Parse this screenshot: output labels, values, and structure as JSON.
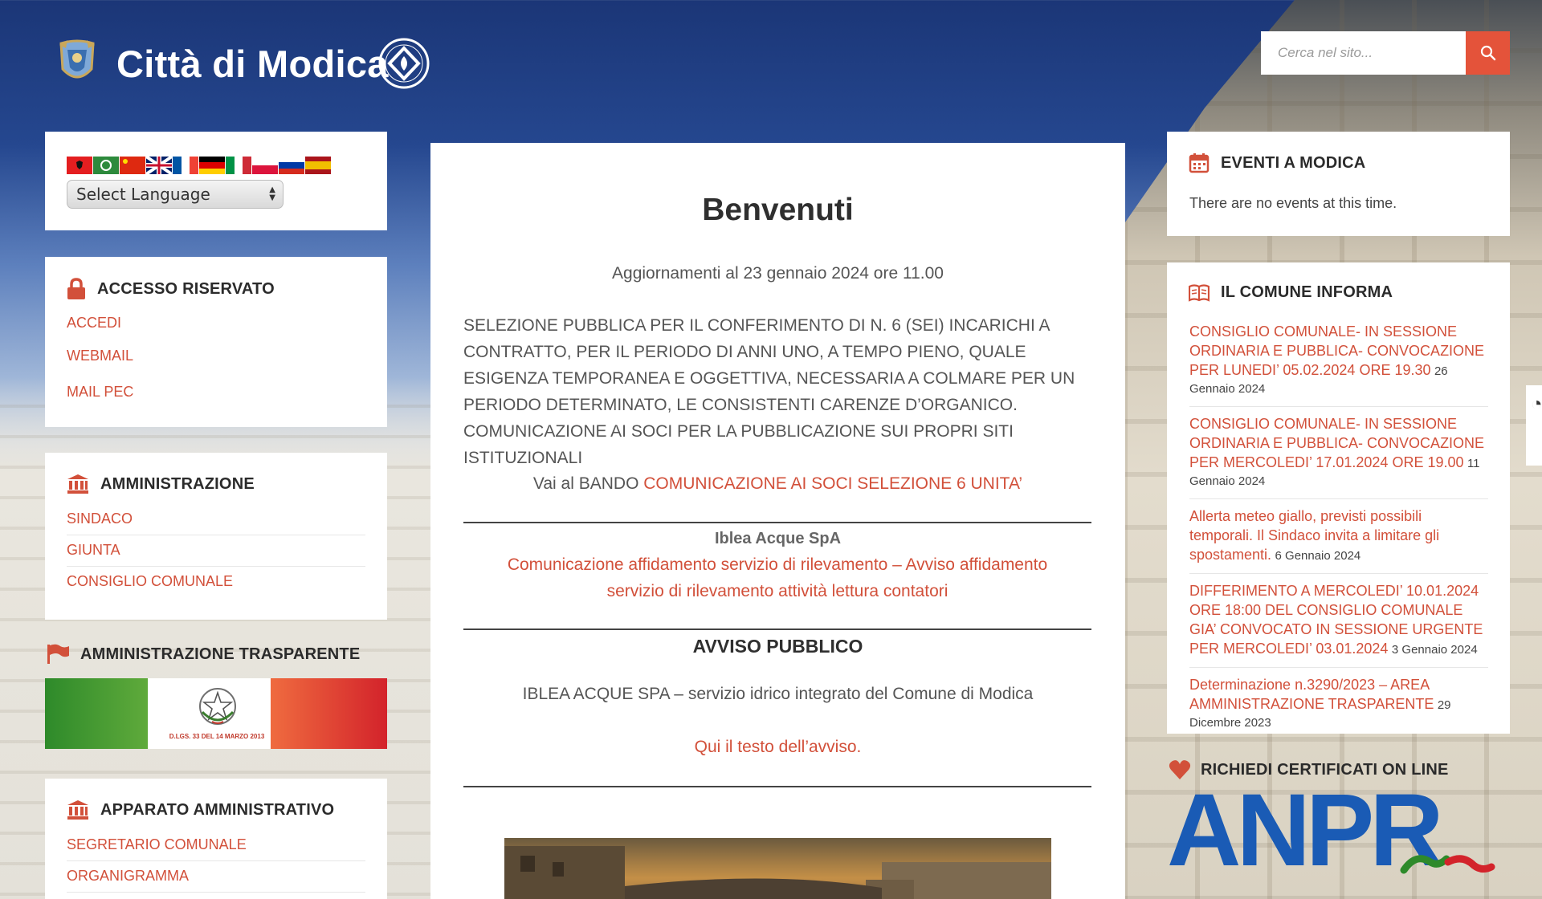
{
  "header": {
    "site_title": "Città di Modica",
    "search_placeholder": "Cerca nel sito..."
  },
  "colors": {
    "accent": "#d2503a",
    "search_button": "#e4533a",
    "header_blue": "#1b3677"
  },
  "language": {
    "select_label": "Select Language",
    "flags": [
      "albania-flag",
      "arabic-flag",
      "china-flag",
      "uk-flag",
      "france-flag",
      "germany-flag",
      "italy-flag",
      "poland-flag",
      "russia-flag",
      "spain-flag"
    ]
  },
  "accesso": {
    "title": "ACCESSO RISERVATO",
    "links": [
      "ACCEDI",
      "WEBMAIL",
      "MAIL PEC"
    ]
  },
  "amministrazione": {
    "title": "AMMINISTRAZIONE",
    "links": [
      "SINDACO",
      "GIUNTA",
      "CONSIGLIO COMUNALE"
    ]
  },
  "trasparente": {
    "title": "AMMINISTRAZIONE TRASPARENTE",
    "banner_text": "D.LGS. 33 DEL 14 MARZO 2013"
  },
  "apparato": {
    "title": "APPARATO AMMINISTRATIVO",
    "links": [
      "SEGRETARIO COMUNALE",
      "ORGANIGRAMMA"
    ]
  },
  "main": {
    "title": "Benvenuti",
    "update": "Aggiornamenti al 23 gennaio 2024 ore 11.00",
    "selezione": "SELEZIONE PUBBLICA PER IL CONFERIMENTO DI N. 6 (SEI) INCARICHI A CONTRATTO, PER IL PERIODO DI ANNI UNO, A TEMPO PIENO, QUALE ESIGENZA TEMPORANEA E OGGETTIVA, NECESSARIA A COLMARE PER UN PERIODO DETERMINATO, LE CONSISTENTI CARENZE D’ORGANICO. COMUNICAZIONE AI SOCI PER LA PUBBLICAZIONE SUI PROPRI SITI ISTITUZIONALI",
    "bando_prefix": "Vai al BANDO",
    "bando_link": "COMUNICAZIONE AI SOCI SELEZIONE 6 UNITA’",
    "iblea_title": "Iblea Acque SpA",
    "iblea_link": "Comunicazione affidamento servizio di rilevamento – Avviso affidamento servizio di rilevamento attività lettura contatori",
    "avviso_title": "AVVISO PUBBLICO",
    "avviso_text": "IBLEA ACQUE SPA – servizio idrico integrato del Comune di Modica",
    "avviso_link": "Qui il testo dell’avviso."
  },
  "eventi": {
    "title": "EVENTI A MODICA",
    "text": "There are no events at this time."
  },
  "comune": {
    "title": "IL COMUNE INFORMA",
    "items": [
      {
        "link": "CONSIGLIO COMUNALE- IN SESSIONE ORDINARIA E PUBBLICA- CONVOCAZIONE PER LUNEDI’ 05.02.2024 ORE 19.30",
        "date_a": "26",
        "date_b": "Gennaio 2024"
      },
      {
        "link": "CONSIGLIO COMUNALE- IN SESSIONE ORDINARIA E PUBBLICA- CONVOCAZIONE PER MERCOLEDI’ 17.01.2024 ORE 19.00",
        "date_a": "11",
        "date_b": "Gennaio 2024"
      },
      {
        "link": "Allerta meteo giallo, previsti possibili temporali. Il Sindaco invita a limitare gli spostamenti.",
        "date_a": "6 Gennaio 2024",
        "date_b": ""
      },
      {
        "link": "DIFFERIMENTO A MERCOLEDI’ 10.01.2024 ORE 18:00 DEL CONSIGLIO COMUNALE GIA’ CONVOCATO IN SESSIONE URGENTE PER MERCOLEDI’ 03.01.2024",
        "date_a": "3 Gennaio 2024",
        "date_b": ""
      },
      {
        "link": "Determinazione n.3290/2023 – AREA AMMINISTRAZIONE TRASPARENTE",
        "date_a": "29",
        "date_b": "Dicembre 2023"
      }
    ]
  },
  "certificati": {
    "title": "RICHIEDI CERTIFICATI ON LINE",
    "logo_text": "ANPR"
  }
}
